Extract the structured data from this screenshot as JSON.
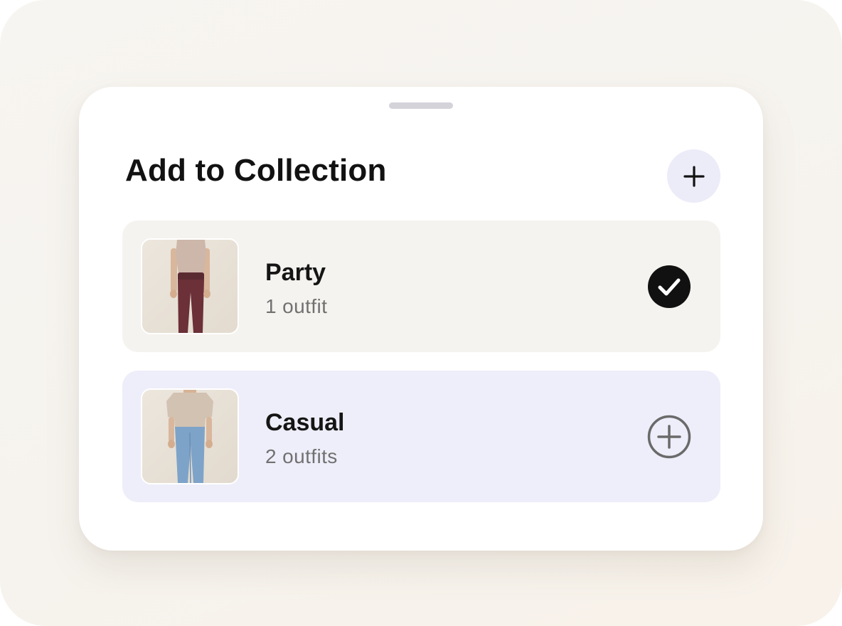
{
  "sheet": {
    "title": "Add to Collection",
    "add_button_icon": "plus-icon"
  },
  "collections": [
    {
      "name": "Party",
      "count_label": "1 outfit",
      "selected": true,
      "action_icon": "checkmark-circle-icon",
      "thumbnail": "outfit-photo-beige-top-burgundy-pants",
      "background": "#f5f3ef"
    },
    {
      "name": "Casual",
      "count_label": "2 outfits",
      "selected": false,
      "action_icon": "plus-circle-icon",
      "thumbnail": "outfit-photo-beige-sweater-blue-jeans",
      "background": "#eeeefa"
    }
  ],
  "colors": {
    "accent_selected": "#111111",
    "add_button_bg": "#ecebf8",
    "text_primary": "#121212",
    "text_secondary": "#717171"
  }
}
